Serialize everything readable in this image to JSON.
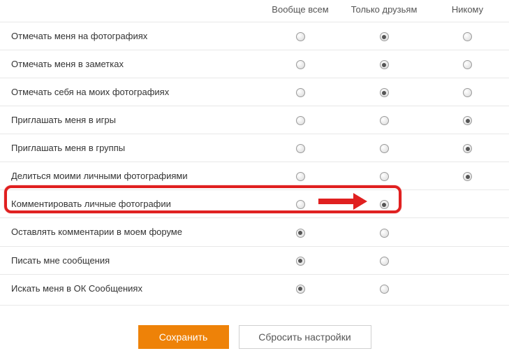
{
  "columns": {
    "label": "",
    "all": "Вообще всем",
    "friends": "Только друзьям",
    "none": "Никому"
  },
  "rows": [
    {
      "label": "Отмечать меня на фотографиях",
      "all": false,
      "friends": true,
      "none": false
    },
    {
      "label": "Отмечать меня в заметках",
      "all": false,
      "friends": true,
      "none": false
    },
    {
      "label": "Отмечать себя на моих фотографиях",
      "all": false,
      "friends": true,
      "none": false
    },
    {
      "label": "Приглашать меня в игры",
      "all": false,
      "friends": false,
      "none": true
    },
    {
      "label": "Приглашать меня в группы",
      "all": false,
      "friends": false,
      "none": true
    },
    {
      "label": "Делиться моими личными фотографиями",
      "all": false,
      "friends": false,
      "none": true
    },
    {
      "label": "Комментировать личные фотографии",
      "all": false,
      "friends": true,
      "none": null
    },
    {
      "label": "Оставлять комментарии в моем форуме",
      "all": true,
      "friends": false,
      "none": null
    },
    {
      "label": "Писать мне сообщения",
      "all": true,
      "friends": false,
      "none": null
    },
    {
      "label": "Искать меня в ОК Сообщениях",
      "all": true,
      "friends": false,
      "none": null
    }
  ],
  "buttons": {
    "save": "Сохранить",
    "reset": "Сбросить настройки"
  },
  "highlight_row_index": 6
}
